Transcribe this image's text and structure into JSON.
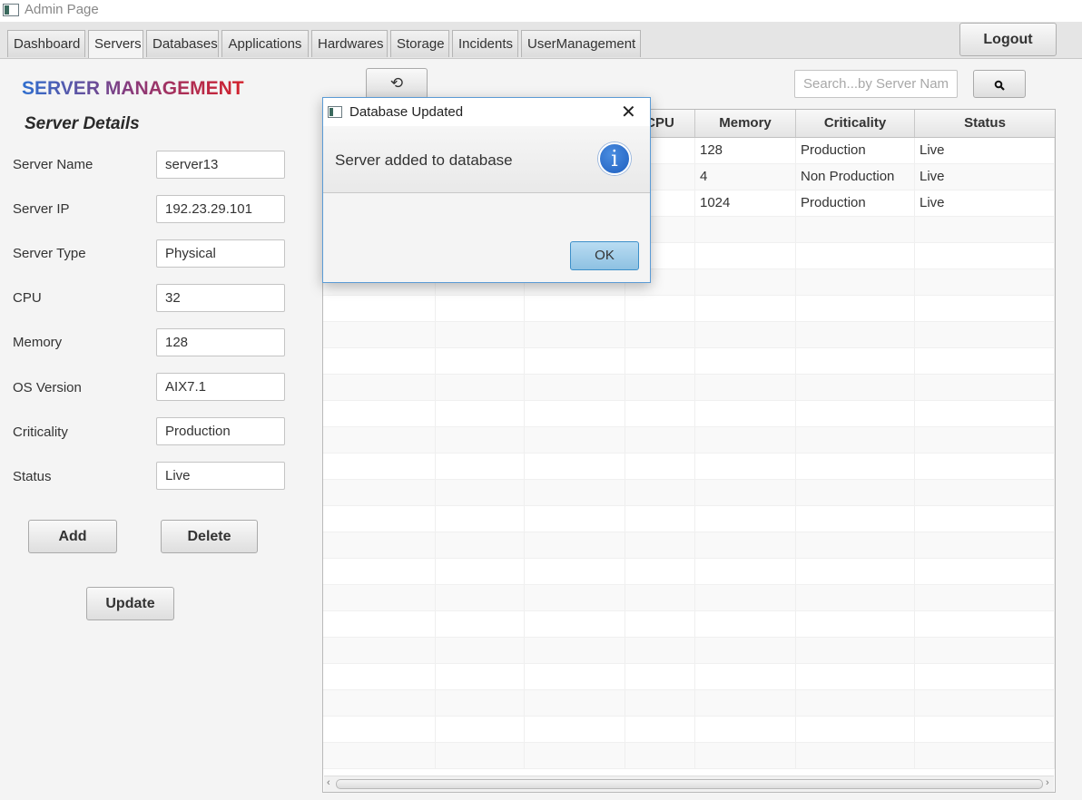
{
  "window": {
    "title": "Admin Page"
  },
  "tabs": [
    {
      "label": "Dashboard",
      "selected": false
    },
    {
      "label": "Servers",
      "selected": true
    },
    {
      "label": "Databases",
      "selected": false
    },
    {
      "label": "Applications",
      "selected": false
    },
    {
      "label": "Hardwares",
      "selected": false
    },
    {
      "label": "Storage",
      "selected": false
    },
    {
      "label": "Incidents",
      "selected": false
    },
    {
      "label": "UserManagement",
      "selected": false
    }
  ],
  "logout_label": "Logout",
  "left_panel": {
    "heading": "SERVER MANAGEMENT",
    "subheading": "Server Details",
    "fields": [
      {
        "label": "Server Name",
        "value": "server13"
      },
      {
        "label": "Server IP",
        "value": "192.23.29.101"
      },
      {
        "label": "Server Type",
        "value": "Physical"
      },
      {
        "label": "CPU",
        "value": "32"
      },
      {
        "label": "Memory",
        "value": "128"
      },
      {
        "label": "OS Version",
        "value": "AIX7.1"
      },
      {
        "label": "Criticality",
        "value": "Production"
      },
      {
        "label": "Status",
        "value": "Live"
      }
    ],
    "add_label": "Add",
    "delete_label": "Delete",
    "update_label": "Update"
  },
  "toolbar": {
    "refresh_icon": "refresh-icon",
    "search_placeholder": "Search...by Server Name",
    "search_icon": "search-icon"
  },
  "table": {
    "columns": [
      "",
      "",
      "",
      "CPU",
      "Memory",
      "Criticality",
      "Status"
    ],
    "rows": [
      [
        "",
        "",
        "",
        "",
        "128",
        "Production",
        "Live"
      ],
      [
        "",
        "",
        "",
        "",
        "4",
        "Non Production",
        "Live"
      ],
      [
        "",
        "",
        "",
        "",
        "1024",
        "Production",
        "Live"
      ]
    ],
    "empty_rows": 21
  },
  "dialog": {
    "title": "Database Updated",
    "message": "Server added to database",
    "icon": "info-icon",
    "ok_label": "OK"
  }
}
